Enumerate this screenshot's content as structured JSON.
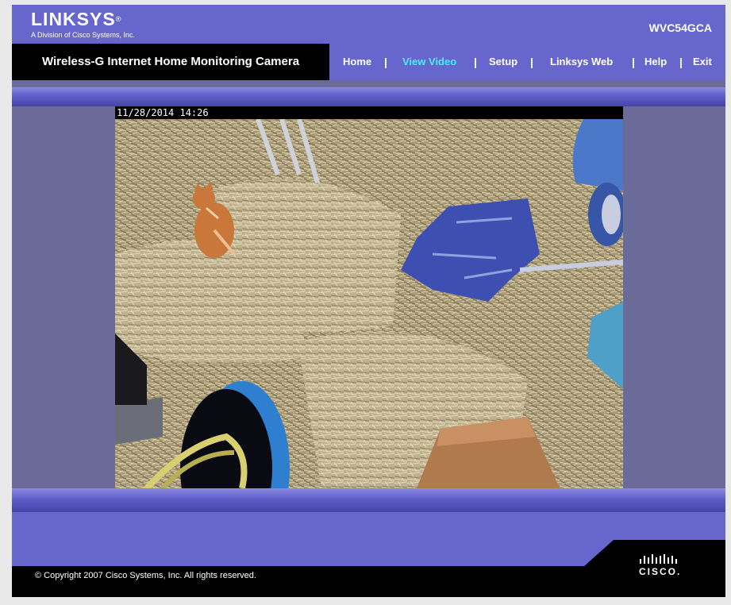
{
  "header": {
    "brand": "LINKSYS",
    "brand_mark": "®",
    "tagline": "A Division of Cisco Systems, Inc.",
    "model": "WVC54GCA"
  },
  "product_title": "Wireless-G Internet Home Monitoring Camera",
  "nav": {
    "items": [
      {
        "label": "Home",
        "active": false
      },
      {
        "label": "View Video",
        "active": true
      },
      {
        "label": "Setup",
        "active": false
      },
      {
        "label": "Linksys Web",
        "active": false
      },
      {
        "label": "Help",
        "active": false
      },
      {
        "label": "Exit",
        "active": false
      }
    ],
    "separator": "|",
    "active_color": "#43f1ff"
  },
  "video": {
    "timestamp": "11/28/2014 14:26",
    "scene_icons": [
      "hay-bale",
      "cat",
      "ladder",
      "blue-tarp",
      "hose-reel",
      "wooden-board"
    ]
  },
  "footer": {
    "copyright": "© Copyright 2007 Cisco Systems, Inc. All rights reserved.",
    "cisco_logo_text": "CISCO."
  },
  "colors": {
    "brand_purple": "#6766cc",
    "frame_gray": "#6a6b98",
    "black": "#000000"
  }
}
